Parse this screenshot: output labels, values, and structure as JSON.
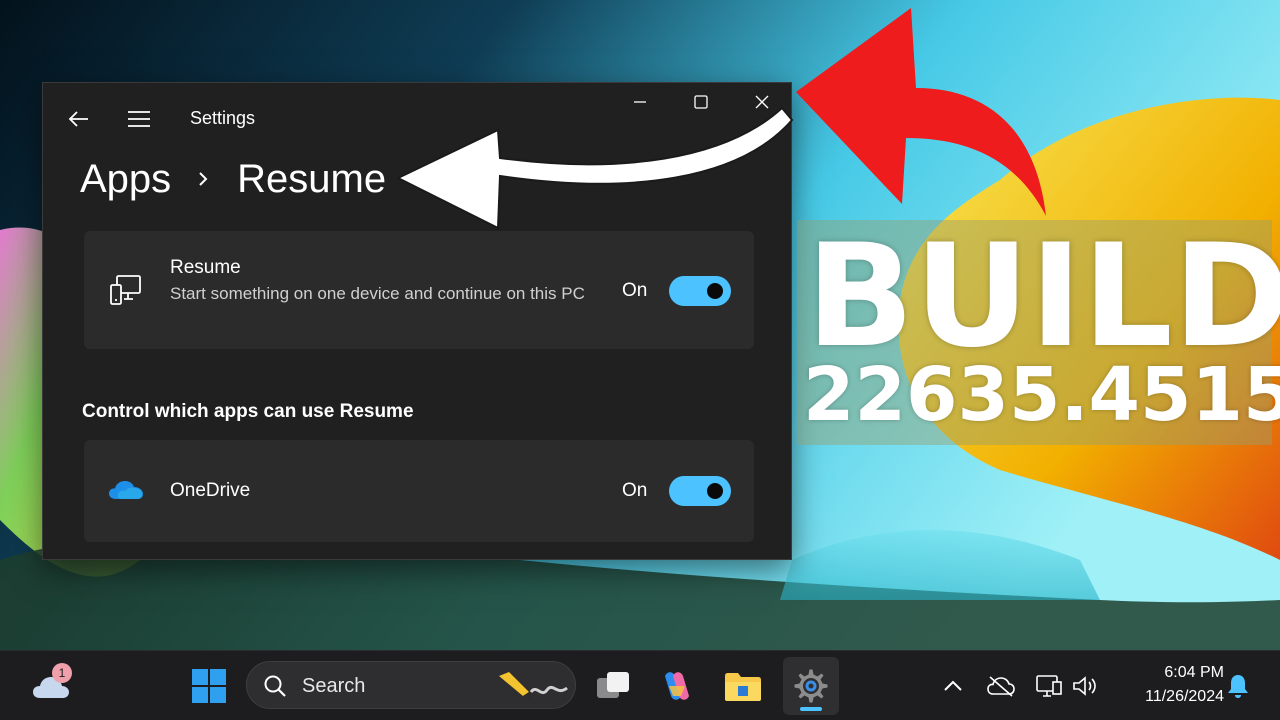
{
  "window": {
    "title": "Settings",
    "breadcrumb": {
      "parent": "Apps",
      "separator": "›",
      "current": "Resume"
    }
  },
  "resume_card": {
    "title": "Resume",
    "description": "Start something on one device and continue on this PC",
    "toggle_label": "On",
    "toggle_on": true,
    "icon": "devices-icon"
  },
  "section": {
    "heading": "Control which apps can use Resume"
  },
  "apps": [
    {
      "name": "OneDrive",
      "toggle_label": "On",
      "toggle_on": true,
      "icon": "onedrive-icon"
    }
  ],
  "overlay": {
    "build_word": "BUILD",
    "build_number": "22635.4515"
  },
  "taskbar": {
    "weather_badge": "1",
    "search_label": "Search",
    "clock_time": "6:04 PM",
    "clock_date": "11/26/2024"
  },
  "colors": {
    "accent": "#4cc2ff",
    "window_bg": "#202020",
    "card_bg": "#2b2b2b",
    "arrow_red": "#ee1c1c"
  }
}
